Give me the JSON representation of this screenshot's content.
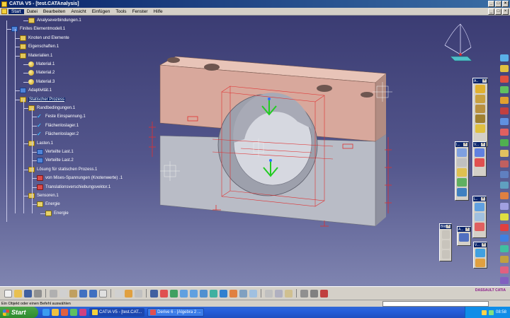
{
  "window": {
    "title": "CATIA V5 - [test.CATAnalysis]"
  },
  "menu": {
    "items": [
      "Start",
      "Datei",
      "Bearbeiten",
      "Ansicht",
      "Einfügen",
      "Tools",
      "Fenster",
      "Hilfe"
    ]
  },
  "tree": {
    "nodes": [
      {
        "label": "Analyseverbindungen.1",
        "indent": 3,
        "icon": "folder"
      },
      {
        "label": "Finites Elementmodell.1",
        "indent": 1,
        "icon": "blue"
      },
      {
        "label": "Knoten und Elemente",
        "indent": 2,
        "icon": "folder"
      },
      {
        "label": "Eigenschaften.1",
        "indent": 2,
        "icon": "folder"
      },
      {
        "label": "Materialien.1",
        "indent": 2,
        "icon": "folder"
      },
      {
        "label": "Material.1",
        "indent": 3,
        "icon": "mat"
      },
      {
        "label": "Material.2",
        "indent": 3,
        "icon": "mat"
      },
      {
        "label": "Material.3",
        "indent": 3,
        "icon": "mat"
      },
      {
        "label": "Adaptivität.1",
        "indent": 2,
        "icon": "blue"
      },
      {
        "label": "Statischer Prozess",
        "indent": 2,
        "icon": "folder"
      },
      {
        "label": "Randbedingungen.1",
        "indent": 3,
        "icon": "folder"
      },
      {
        "label": "Feste Einspannung.1",
        "indent": 4,
        "icon": "check"
      },
      {
        "label": "Flächenloslager.1",
        "indent": 4,
        "icon": "check"
      },
      {
        "label": "Flächenloslager.2",
        "indent": 4,
        "icon": "check"
      },
      {
        "label": "Lasten.1",
        "indent": 3,
        "icon": "folder"
      },
      {
        "label": "Verteilte Last.1",
        "indent": 4,
        "icon": "blue"
      },
      {
        "label": "Verteilte Last.2",
        "indent": 4,
        "icon": "blue"
      },
      {
        "label": "Lösung für statischen Prozess.1",
        "indent": 3,
        "icon": "folder"
      },
      {
        "label": "von Mises-Spannungen (Knotenwerte) .1",
        "indent": 4,
        "icon": "red"
      },
      {
        "label": "Translationsverschiebungsvektor.1",
        "indent": 4,
        "icon": "red"
      },
      {
        "label": "Sensoren.1",
        "indent": 3,
        "icon": "folder"
      },
      {
        "label": "Energie",
        "indent": 4,
        "icon": "energy"
      },
      {
        "label": "Energie",
        "indent": 5,
        "icon": "energy"
      }
    ]
  },
  "toolbars": {
    "a_label": "A..",
    "i_label": "I...",
    "v_label": "V...",
    "l_label": "L..",
    "bild_label": "Bild",
    "a2_label": "A...",
    "v2_label": "V..."
  },
  "status": {
    "text": "Ein Objekt oder einen Befehl auswählen"
  },
  "bottom": {
    "logo": "DASSAULT CATIA"
  },
  "taskbar": {
    "start": "Start",
    "tasks": [
      {
        "label": "CATIA V5 - [test.CAT...",
        "active": true
      },
      {
        "label": "Derive 6 - [Algebra 2 ...",
        "active": false
      }
    ],
    "clock": "08:58"
  },
  "colors": {
    "viewport_top": "#3b3c73",
    "viewport_bottom": "#7f84b0",
    "part_top": "#d8a89c",
    "part_bottom": "#b9bcc6",
    "constraint_red": "#e03030",
    "load_green": "#22cc22"
  }
}
